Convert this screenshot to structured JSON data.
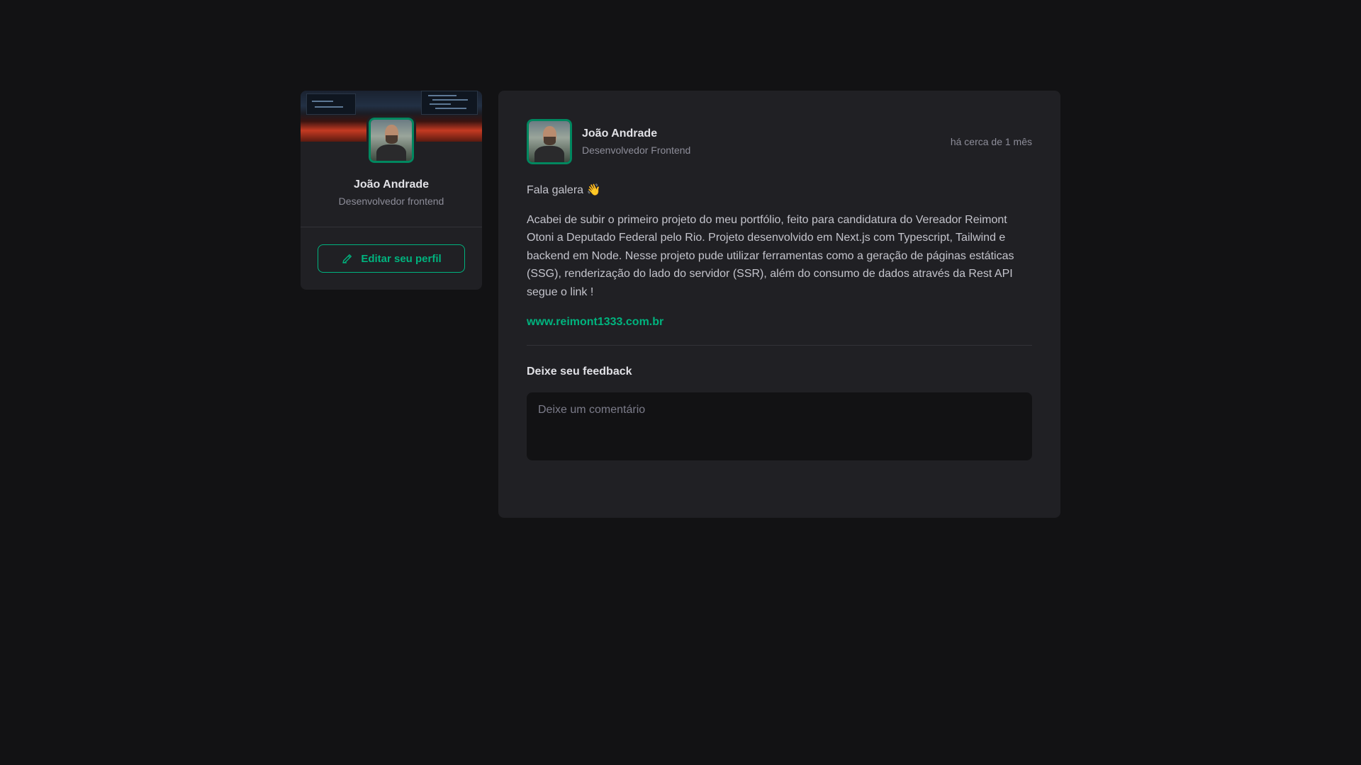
{
  "sidebar": {
    "cover_image": "desk-setup-cover-image",
    "avatar": "profile-photo",
    "name": "João Andrade",
    "role": "Desenvolvedor frontend",
    "edit_button": {
      "icon": "pencil-icon",
      "label": "Editar seu perfil"
    }
  },
  "post": {
    "author": {
      "avatar": "profile-photo",
      "name": "João Andrade",
      "role": "Desenvolvedor Frontend"
    },
    "time": "há cerca de 1 mês",
    "greeting": "Fala galera 👋",
    "body": "Acabei de subir o primeiro projeto do meu portfólio, feito para candidatura do Vereador Reimont Otoni a Deputado Federal pelo Rio. Projeto desenvolvido em Next.js com Typescript, Tailwind e backend em Node. Nesse projeto pude utilizar ferramentas como a geração de páginas estáticas (SSG), renderização do lado do servidor (SSR), além do consumo de dados através da Rest API segue o link !",
    "link": "www.reimont1333.com.br",
    "feedback": {
      "title": "Deixe seu feedback",
      "placeholder": "Deixe um comentário",
      "value": ""
    }
  },
  "colors": {
    "background": "#121214",
    "card": "#202024",
    "accent": "#00b37e",
    "avatar_border": "#00875f"
  }
}
